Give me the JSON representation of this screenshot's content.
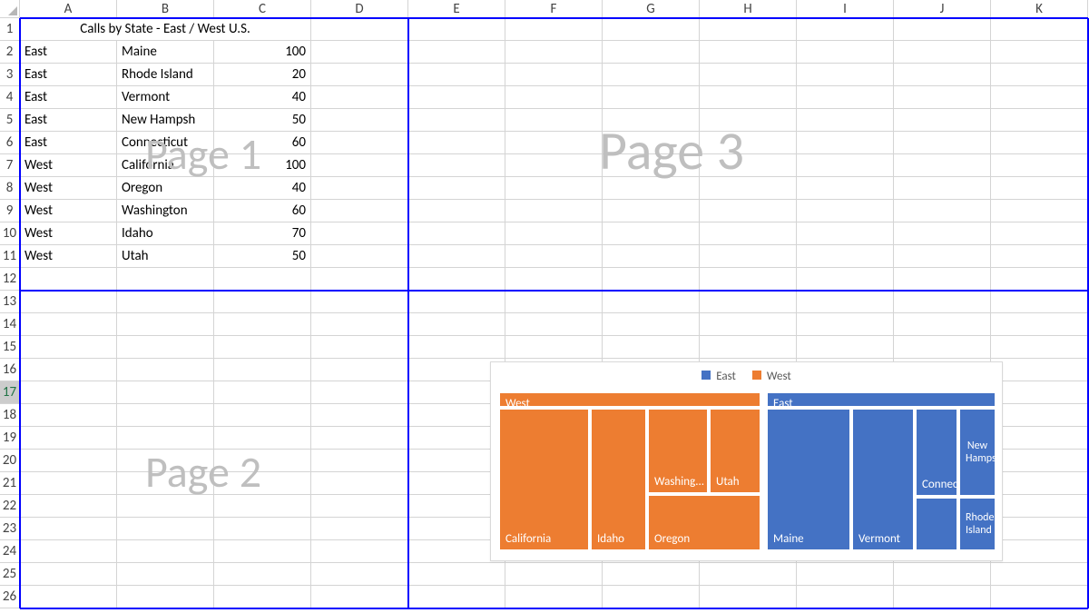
{
  "columns": [
    "A",
    "B",
    "C",
    "D",
    "E",
    "F",
    "G",
    "H",
    "I",
    "J",
    "K"
  ],
  "rows_visible": 26,
  "row_header_width": 22,
  "col_header_height": 20,
  "row_heights": {
    "default": 25
  },
  "col_widths": {
    "A": 107,
    "B": 107,
    "C": 107,
    "D": 107,
    "E": 107,
    "F": 107,
    "G": 107,
    "H": 107,
    "I": 107,
    "J": 107,
    "K": 107
  },
  "title_cell": "Calls by State - East / West U.S.",
  "data_rows": [
    {
      "region": "East",
      "state": "Maine",
      "calls": 100
    },
    {
      "region": "East",
      "state": "Rhode Island",
      "calls": 20
    },
    {
      "region": "East",
      "state": "Vermont",
      "calls": 40
    },
    {
      "region": "East",
      "state": "New Hampsh",
      "calls": 50
    },
    {
      "region": "East",
      "state": "Connecticut",
      "calls": 60
    },
    {
      "region": "West",
      "state": "California",
      "calls": 100
    },
    {
      "region": "West",
      "state": "Oregon",
      "calls": 40
    },
    {
      "region": "West",
      "state": "Washington",
      "calls": 60
    },
    {
      "region": "West",
      "state": "Idaho",
      "calls": 70
    },
    {
      "region": "West",
      "state": "Utah",
      "calls": 50
    }
  ],
  "watermarks": {
    "p1": "Page 1",
    "p2": "Page 2",
    "p3": "Page 3"
  },
  "selected_row": 17,
  "page_breaks": {
    "top_row": 1,
    "horizontal_row_after": 12,
    "vertical_col_after": "D",
    "bottom_row_after": 26
  },
  "legend": {
    "east": "East",
    "west": "West"
  },
  "treemap_labels": {
    "west_group": "West",
    "california": "California",
    "idaho": "Idaho",
    "washing": "Washing...",
    "utah": "Utah",
    "oregon": "Oregon",
    "east_group": "East",
    "maine": "Maine",
    "vermont": "Vermont",
    "connecticut": "Connectic...",
    "newhamps": "New Hamps...",
    "rhode": "Rhode Island"
  },
  "colors": {
    "east": "#4472c4",
    "west": "#ed7d31",
    "page_break": "#0000ff",
    "watermark": "#bfbfbf"
  },
  "chart_data": {
    "type": "treemap",
    "title": "",
    "series": [
      {
        "name": "East",
        "color": "#4472c4",
        "items": [
          {
            "label": "Maine",
            "value": 100
          },
          {
            "label": "Connecticut",
            "value": 60
          },
          {
            "label": "New Hampshire",
            "value": 50
          },
          {
            "label": "Vermont",
            "value": 40
          },
          {
            "label": "Rhode Island",
            "value": 20
          }
        ]
      },
      {
        "name": "West",
        "color": "#ed7d31",
        "items": [
          {
            "label": "California",
            "value": 100
          },
          {
            "label": "Idaho",
            "value": 70
          },
          {
            "label": "Washington",
            "value": 60
          },
          {
            "label": "Utah",
            "value": 50
          },
          {
            "label": "Oregon",
            "value": 40
          }
        ]
      }
    ]
  }
}
